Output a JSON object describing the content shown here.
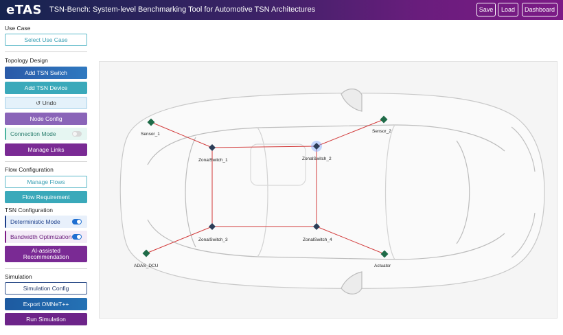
{
  "header": {
    "logo": "eTAS",
    "title": "TSN-Bench: System-level Benchmarking Tool for Automotive TSN Architectures",
    "buttons": {
      "save": "Save",
      "load": "Load",
      "dashboard": "Dashboard"
    },
    "gradient_colors": [
      "#16244f",
      "#7c1a86"
    ]
  },
  "sidebar": {
    "use_case": {
      "title": "Use Case",
      "select_btn": "Select Use Case"
    },
    "topology": {
      "title": "Topology Design",
      "add_switch": "Add TSN Switch",
      "add_device": "Add TSN Device",
      "undo": "↺ Undo",
      "node_config": "Node Config",
      "connection_mode": {
        "label": "Connection Mode",
        "enabled": false
      },
      "manage_links": "Manage Links"
    },
    "flow": {
      "title": "Flow Configuration",
      "manage_flows": "Manage Flows",
      "flow_requirement": "Flow Requirement"
    },
    "tsn": {
      "title": "TSN Configuration",
      "deterministic": {
        "label": "Deterministic Mode",
        "enabled": true
      },
      "bandwidth": {
        "label": "Bandwidth Optimization",
        "enabled": true
      },
      "ai_recommendation": "AI-assisted Recommendation"
    },
    "simulation": {
      "title": "Simulation",
      "config": "Simulation Config",
      "export": "Export OMNeT++",
      "run": "Run Simulation"
    }
  },
  "topology": {
    "link_color": "#d23b3b",
    "node_color": "#1f6b48",
    "switch_color": "#2c3e58",
    "selected_switch": "ZonalSwitch_2",
    "nodes": [
      {
        "id": "Sensor_1",
        "kind": "device"
      },
      {
        "id": "Sensor_2",
        "kind": "device"
      },
      {
        "id": "ADAS_DCU",
        "kind": "device"
      },
      {
        "id": "Actuator",
        "kind": "device"
      },
      {
        "id": "ZonalSwitch_1",
        "kind": "switch"
      },
      {
        "id": "ZonalSwitch_2",
        "kind": "switch"
      },
      {
        "id": "ZonalSwitch_3",
        "kind": "switch"
      },
      {
        "id": "ZonalSwitch_4",
        "kind": "switch"
      }
    ],
    "links": [
      [
        "Sensor_1",
        "ZonalSwitch_1"
      ],
      [
        "Sensor_2",
        "ZonalSwitch_2"
      ],
      [
        "ADAS_DCU",
        "ZonalSwitch_3"
      ],
      [
        "Actuator",
        "ZonalSwitch_4"
      ],
      [
        "ZonalSwitch_1",
        "ZonalSwitch_2"
      ],
      [
        "ZonalSwitch_1",
        "ZonalSwitch_3"
      ],
      [
        "ZonalSwitch_2",
        "ZonalSwitch_4"
      ],
      [
        "ZonalSwitch_3",
        "ZonalSwitch_4"
      ]
    ]
  }
}
